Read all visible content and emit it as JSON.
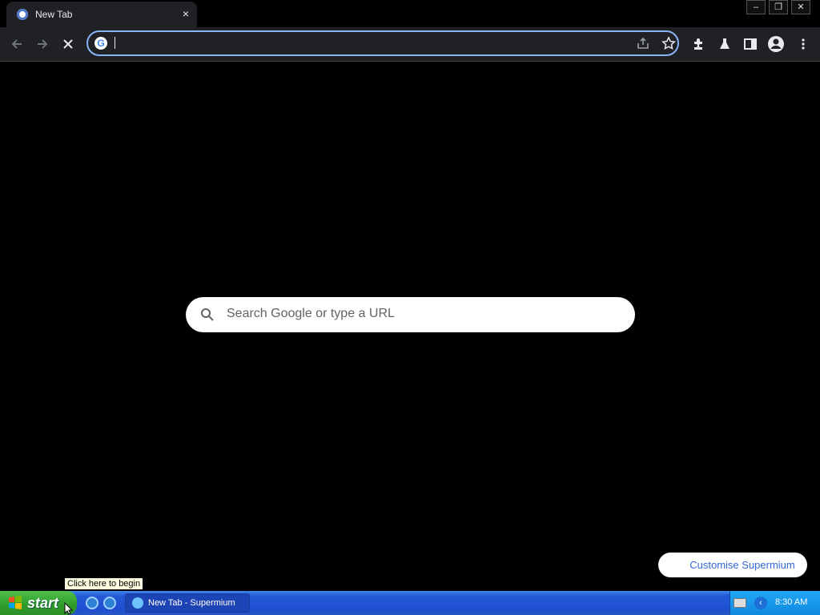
{
  "browser": {
    "tab": {
      "title": "New Tab",
      "close_symbol": "×"
    },
    "window_controls": {
      "minimize": "–",
      "restore": "❐",
      "close": "✕"
    },
    "omnibox": {
      "value": "",
      "provider_glyph": "G"
    }
  },
  "page": {
    "search_placeholder": "Search Google or type a URL",
    "customise_label": "Customise Supermium"
  },
  "taskbar": {
    "start_label": "start",
    "task_item_label": "New Tab - Supermium",
    "clock": "8:30 AM",
    "tooltip": "Click here to begin"
  },
  "icons": {
    "nav": [
      "back-icon",
      "forward-icon",
      "stop-icon"
    ],
    "omnibox_right": [
      "share-icon",
      "bookmark-star-icon"
    ],
    "toolbar_right": [
      "extensions-icon",
      "labs-icon",
      "side-panel-icon",
      "profile-icon",
      "menu-icon"
    ]
  },
  "colors": {
    "accent": "#8ab4f8",
    "toolbar_bg": "#202124",
    "taskbar_blue": "#2458d6",
    "start_green": "#2e9a2a"
  }
}
